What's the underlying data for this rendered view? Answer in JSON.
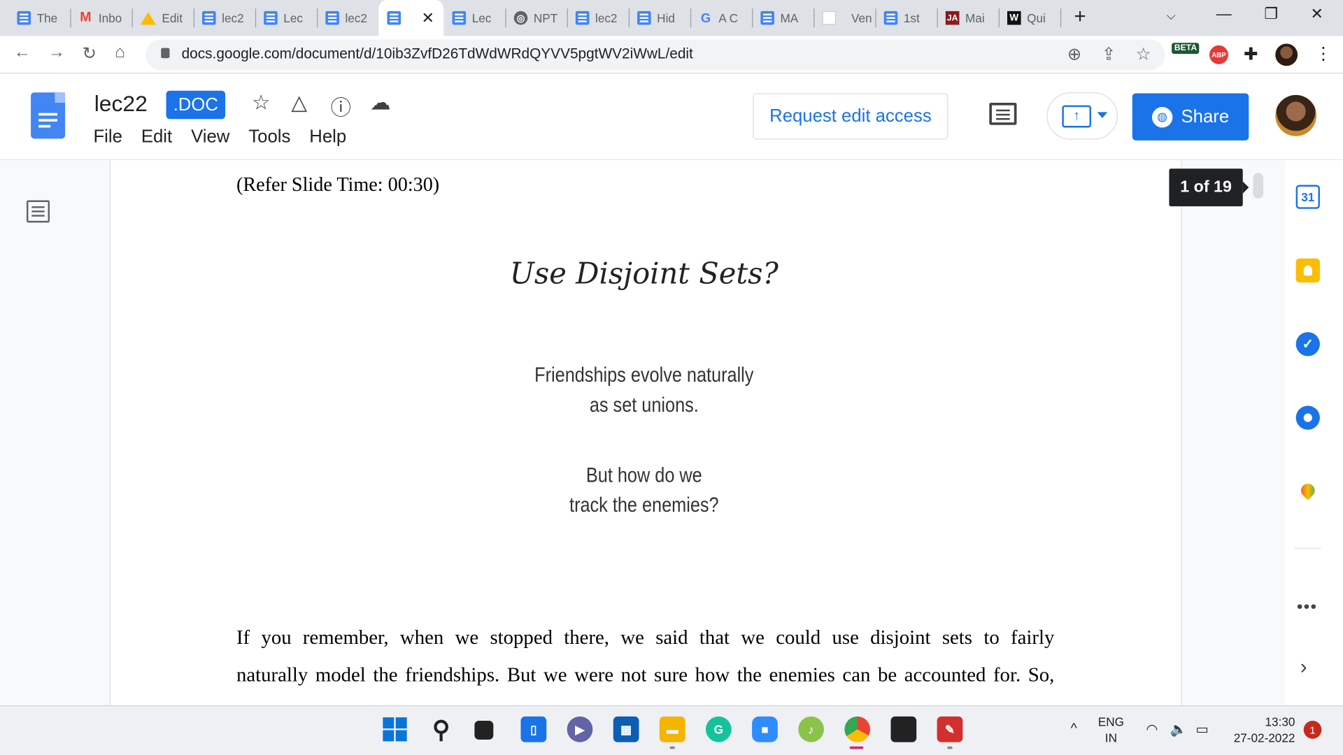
{
  "browser": {
    "tabs": [
      {
        "label": "The",
        "icon": "docs-icon"
      },
      {
        "label": "Inbo",
        "icon": "gmail-icon"
      },
      {
        "label": "Edit",
        "icon": "drive-icon"
      },
      {
        "label": "lec2",
        "icon": "docs-icon"
      },
      {
        "label": "Lec",
        "icon": "docs-icon"
      },
      {
        "label": "lec2",
        "icon": "docs-icon"
      },
      {
        "label": "",
        "icon": "docs-icon",
        "active": true
      },
      {
        "label": "Lec",
        "icon": "docs-icon"
      },
      {
        "label": "NPT",
        "icon": "globe-icon"
      },
      {
        "label": "lec2",
        "icon": "docs-icon"
      },
      {
        "label": "Hid",
        "icon": "docs-icon"
      },
      {
        "label": "A C",
        "icon": "google-icon"
      },
      {
        "label": "MA",
        "icon": "docs-icon"
      },
      {
        "label": "Ven",
        "icon": "blank-icon"
      },
      {
        "label": "1st",
        "icon": "docs-icon"
      },
      {
        "label": "Mai",
        "icon": "ja-icon"
      },
      {
        "label": "Qui",
        "icon": "w-icon"
      }
    ],
    "url": "docs.google.com/document/d/10ib3ZvfD26TdWdWRdQYVV5pgtWV2iWwL/edit",
    "extension_badge": "BETA",
    "abp_label": "ABP"
  },
  "docs": {
    "title": "lec22",
    "file_type": ".DOC",
    "menu": [
      "File",
      "Edit",
      "View",
      "Tools",
      "Help"
    ],
    "request_edit": "Request edit access",
    "share": "Share",
    "page_indicator": "1 of 19"
  },
  "document": {
    "refer_line": "(Refer Slide Time: 00:30)",
    "slide_title": "Use Disjoint Sets?",
    "slide_lines": [
      "Friendships evolve naturally",
      "as set unions.",
      "But how do we",
      "track the enemies?"
    ],
    "paragraph_lines": [
      "If you remember, when we stopped there, we said that we could use disjoint sets to fairly",
      "naturally model the friendships. But we were not sure how the enemies can be accounted for. So,"
    ]
  },
  "side_panel": {
    "calendar_day": "31",
    "more": "•••",
    "expand": "›"
  },
  "taskbar": {
    "lang_line1": "ENG",
    "lang_line2": "IN",
    "time": "13:30",
    "date": "27-02-2022",
    "notifications": "1"
  }
}
